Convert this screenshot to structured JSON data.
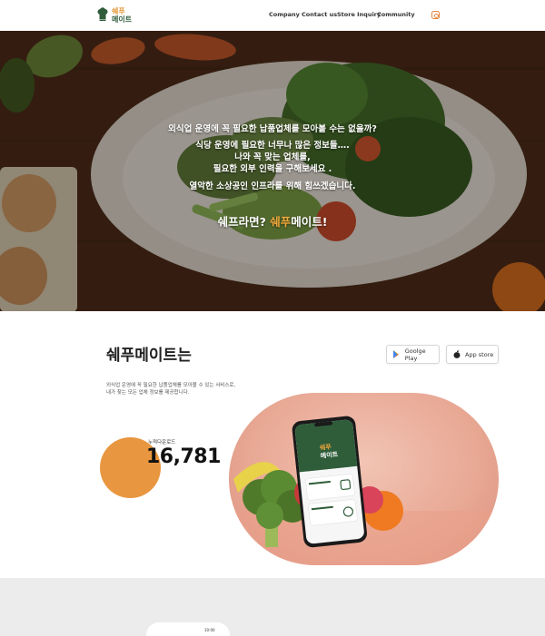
{
  "header": {
    "logo_line1": "쉐푸",
    "logo_line2": "메이트",
    "nav": [
      "Company",
      "Contact us",
      "Store Inquiry",
      "Community"
    ]
  },
  "hero": {
    "line1": "외식업 운영에 꼭 필요한 납품업체를 모아볼 수는 없을까?",
    "line2": "식당 운영에 필요한 너무나 많은 정보들….",
    "line3": "나와 꼭 맞는 업체를,",
    "line4": "필요한 외부 인력을 구해보세요 .",
    "line5": "열악한 소상공인 인프라를 위해 힘쓰겠습니다.",
    "cta_prefix": "쉐프라면? ",
    "cta_accent": "쉐푸",
    "cta_suffix": "메이트!"
  },
  "about": {
    "title": "쉐푸메이트는",
    "desc_line1": "외식업 운영에 꼭 필요한 납품업체를 모아볼 수 있는 서비스로,",
    "desc_line2": "내가 찾는 모든 업체 정보를 제공합니다.",
    "google_play": "Goolge Play",
    "app_store": "App store",
    "download_label": "누적다운로드",
    "download_count": "16,781",
    "phone_app_line1": "쉐푸",
    "phone_app_line2": "메이트"
  },
  "bottom": {
    "status_time": "10:00"
  },
  "colors": {
    "accent": "#e8963f",
    "brand_green": "#2f5d3a",
    "hero_accent": "#f2a93a"
  }
}
